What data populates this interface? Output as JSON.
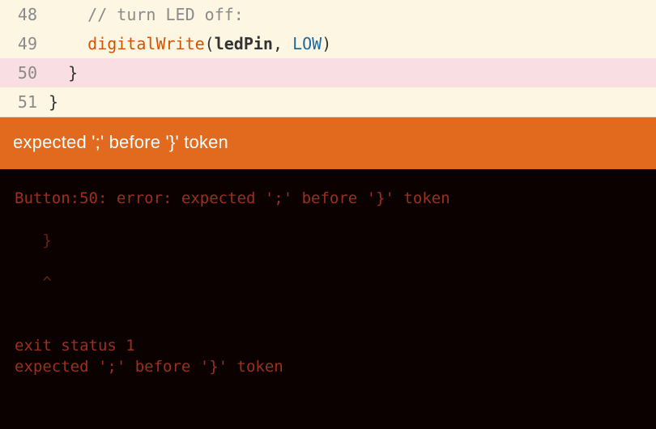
{
  "editor": {
    "lines": [
      {
        "num": "48",
        "highlighted": false,
        "indent": "    ",
        "segments": [
          {
            "cls": "tok-comment",
            "text": "// turn LED off:"
          }
        ]
      },
      {
        "num": "49",
        "highlighted": false,
        "indent": "    ",
        "segments": [
          {
            "cls": "tok-func",
            "text": "digitalWrite"
          },
          {
            "cls": "tok-punct",
            "text": "("
          },
          {
            "cls": "tok-ident",
            "text": "ledPin"
          },
          {
            "cls": "tok-punct",
            "text": ", "
          },
          {
            "cls": "tok-const",
            "text": "LOW"
          },
          {
            "cls": "tok-punct",
            "text": ")"
          }
        ]
      },
      {
        "num": "50",
        "highlighted": true,
        "indent": "  ",
        "segments": [
          {
            "cls": "tok-punct",
            "text": "}"
          }
        ]
      },
      {
        "num": "51",
        "highlighted": false,
        "indent": "",
        "segments": [
          {
            "cls": "tok-punct",
            "text": "}"
          }
        ]
      }
    ]
  },
  "error_banner": {
    "message": "expected ';' before '}' token"
  },
  "console": {
    "lines": [
      {
        "text": "Button:50: error: expected ';' before '}' token",
        "dim": false,
        "blank": false
      },
      {
        "text": "",
        "dim": false,
        "blank": true
      },
      {
        "text": "   }",
        "dim": true,
        "blank": false
      },
      {
        "text": "",
        "dim": false,
        "blank": true
      },
      {
        "text": "   ^",
        "dim": true,
        "blank": false
      },
      {
        "text": "",
        "dim": false,
        "blank": true
      },
      {
        "text": "",
        "dim": false,
        "blank": true
      },
      {
        "text": "exit status 1",
        "dim": false,
        "blank": false
      },
      {
        "text": "expected ';' before '}' token",
        "dim": false,
        "blank": false
      }
    ]
  }
}
